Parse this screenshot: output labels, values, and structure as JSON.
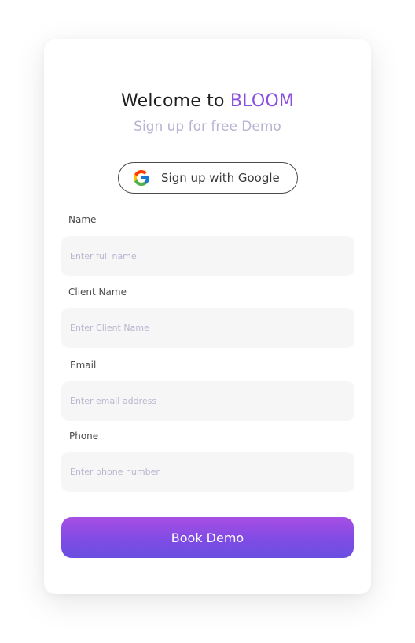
{
  "header": {
    "title_prefix": "Welcome to ",
    "brand": "BLOOM",
    "subtitle": "Sign up for free Demo"
  },
  "google": {
    "label": "Sign up with Google",
    "icon": "google-icon"
  },
  "form": {
    "fields": [
      {
        "label": "Name",
        "placeholder": "Enter full name",
        "value": ""
      },
      {
        "label": "Client Name",
        "placeholder": "Enter Client Name",
        "value": ""
      },
      {
        "label": "Email",
        "placeholder": "Enter email address",
        "value": ""
      },
      {
        "label": "Phone",
        "placeholder": "Enter phone number",
        "value": ""
      }
    ],
    "submit_label": "Book Demo"
  },
  "colors": {
    "brand": "#8a4fe0",
    "subtitle": "#b6b4d2",
    "button_gradient_top": "#a84ee3",
    "button_gradient_bottom": "#6a4fe0",
    "input_bg": "#f6f6f6"
  }
}
